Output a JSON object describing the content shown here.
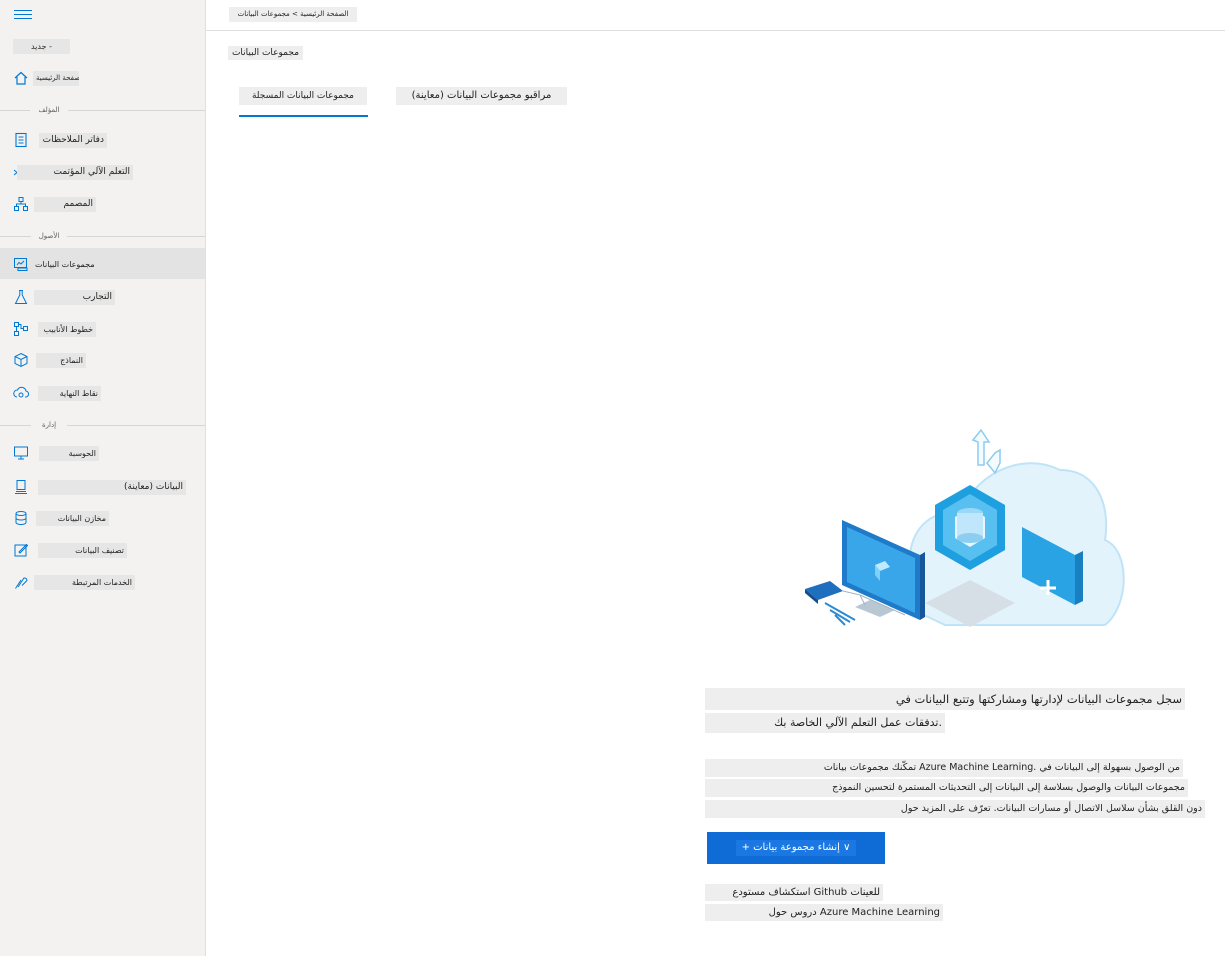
{
  "sidebar": {
    "new_label": "جديد -",
    "home_label": "الصفحة الرئيسية",
    "sections": {
      "author": "المؤلف",
      "assets": "الأصول",
      "manage": "إدارة"
    },
    "items": [
      {
        "label": "دفاتر الملاحظات",
        "icon": "notebook-icon"
      },
      {
        "label": "التعلم الآلي المؤتمت",
        "icon": "automl-icon"
      },
      {
        "label": "المصمم",
        "icon": "designer-icon"
      },
      {
        "label": "مجموعات البيانات",
        "icon": "datasets-icon"
      },
      {
        "label": "التجارب",
        "icon": "flask-icon"
      },
      {
        "label": "خطوط الأنابيب",
        "icon": "pipeline-icon"
      },
      {
        "label": "النماذج",
        "icon": "cube-icon"
      },
      {
        "label": "نقاط النهاية",
        "icon": "endpoint-icon"
      },
      {
        "label": "الحوسبة",
        "icon": "compute-icon"
      },
      {
        "label": "البيانات (معاينة)",
        "icon": "data-preview-icon"
      },
      {
        "label": "مخازن البيانات",
        "icon": "database-icon"
      },
      {
        "label": "تصنيف البيانات",
        "icon": "labeling-icon"
      },
      {
        "label": "الخدمات المرتبطة",
        "icon": "linked-services-icon"
      }
    ]
  },
  "topbar": {
    "breadcrumb": "الصفحة الرئيسية > مجموعات البيانات"
  },
  "main": {
    "title": "مجموعات البيانات",
    "tabs": [
      {
        "label": "مجموعات البيانات المسجلة",
        "active": true
      },
      {
        "label": "مراقبو مجموعات البيانات (معاينة)",
        "active": false
      }
    ],
    "empty_state": {
      "heading_line1": "سجل مجموعات البيانات لإدارتها ومشاركتها وتتبع البيانات في",
      "heading_line2": "تدفقات عمل التعلم الآلي الخاصة بك.",
      "body_line1": "تمكّنك مجموعات بيانات Azure Machine Learning. من الوصول بسهولة إلى البيانات في",
      "body_line2": "مجموعات البيانات والوصول بسلاسة إلى البيانات إلى التحديثات المستمرة لتحسين النموذج",
      "body_line3": "دون القلق بشأن سلاسل الاتصال أو مسارات البيانات. تعرّف على المزيد حول",
      "create_button": "+ إنشاء مجموعة بيانات ∨",
      "link1": "استكشاف مستودع Github للعينات",
      "link2": "دروس حول Azure Machine Learning"
    }
  },
  "colors": {
    "accent": "#0078d4",
    "button": "#0f6cd6"
  }
}
